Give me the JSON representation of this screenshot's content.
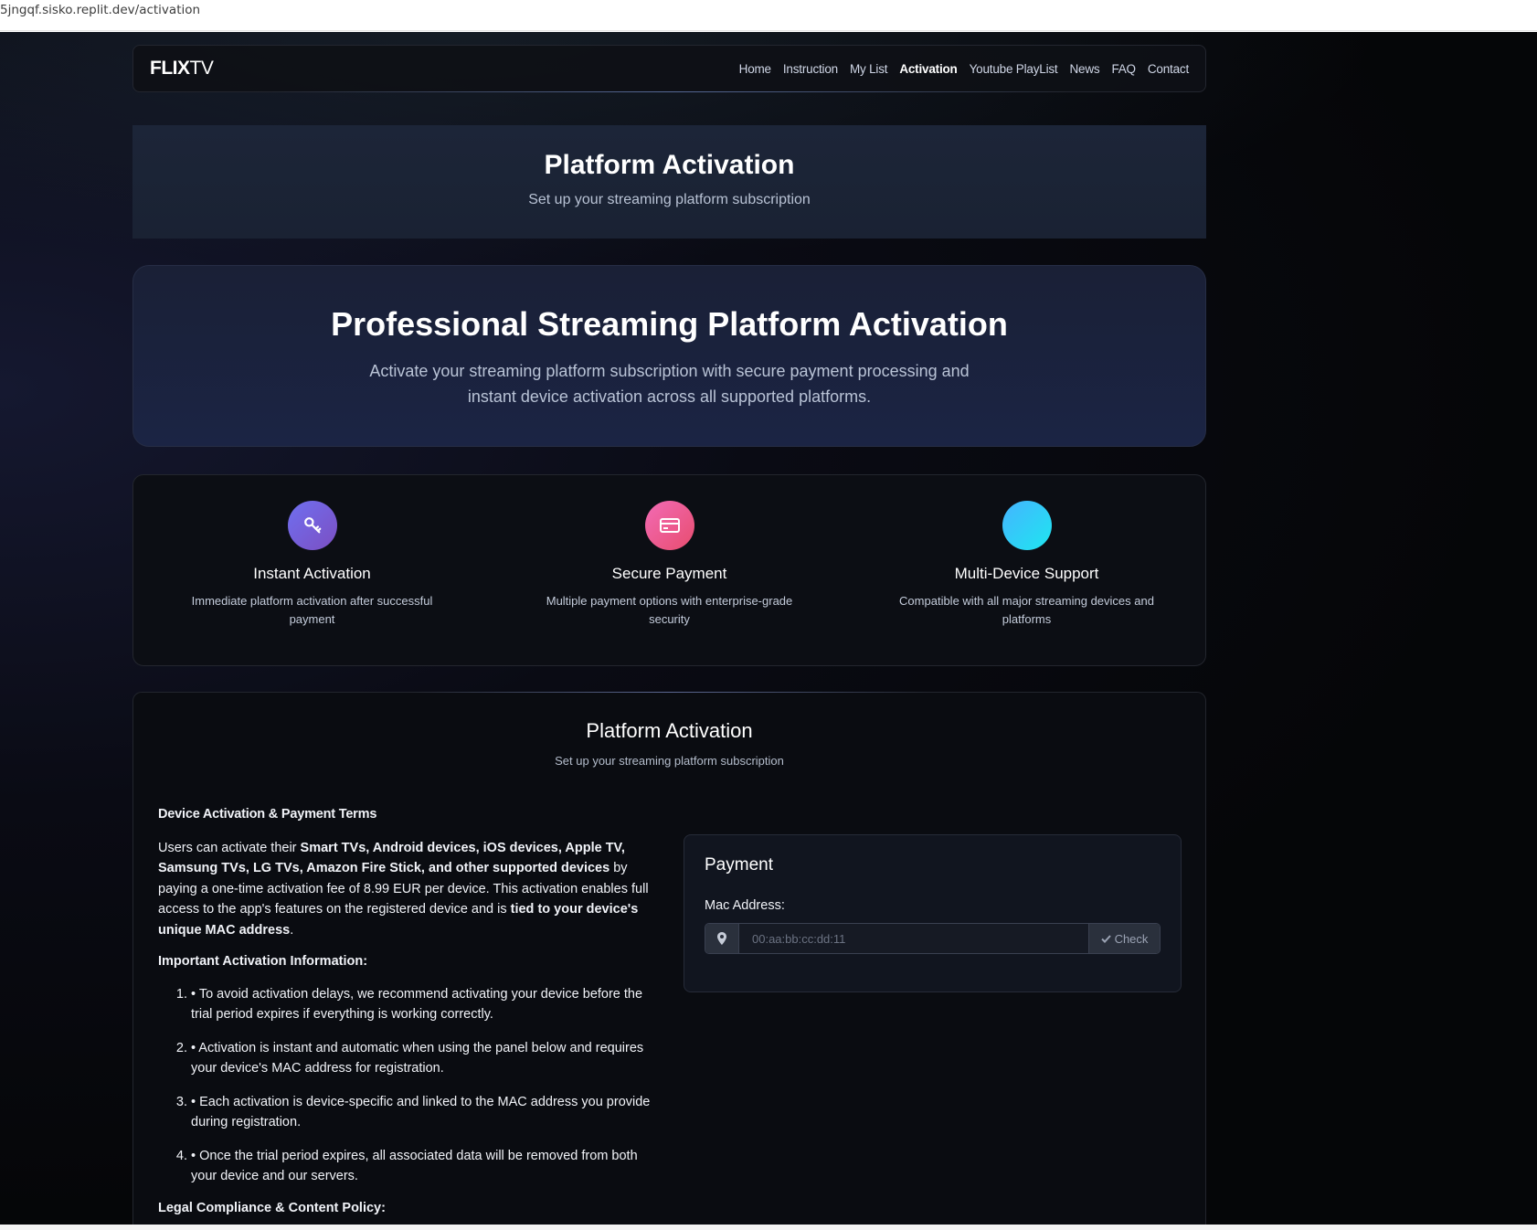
{
  "browser": {
    "url": "5jngqf.sisko.replit.dev/activation"
  },
  "navbar": {
    "brand_bold": "FLIX",
    "brand_light": "TV",
    "links": [
      "Home",
      "Instruction",
      "My List",
      "Activation",
      "Youtube PlayList",
      "News",
      "FAQ",
      "Contact"
    ],
    "active": "Activation"
  },
  "banner": {
    "title": "Platform Activation",
    "subtitle": "Set up your streaming platform subscription"
  },
  "hero": {
    "title": "Professional Streaming Platform Activation",
    "description": "Activate your streaming platform subscription with secure payment processing and instant device activation across all supported platforms."
  },
  "features": [
    {
      "icon": "key-icon",
      "title": "Instant Activation",
      "text": "Immediate platform activation after successful payment",
      "color": "#6f6ff0"
    },
    {
      "icon": "credit-card-icon",
      "title": "Secure Payment",
      "text": "Multiple payment options with enterprise-grade security",
      "color": "#f26bb5"
    },
    {
      "icon": "devices-icon",
      "title": "Multi-Device Support",
      "text": "Compatible with all major streaming devices and platforms",
      "color": "#1ee6f0"
    }
  ],
  "panel": {
    "title": "Platform Activation",
    "subtitle": "Set up your streaming platform subscription"
  },
  "terms": {
    "heading": "Device Activation & Payment Terms",
    "intro_before": "Users can activate their ",
    "intro_bold": "Smart TVs, Android devices, iOS devices, Apple TV, Samsung TVs, LG TVs, Amazon Fire Stick, and other supported devices",
    "intro_middle": " by paying a one-time activation fee of 8.99 EUR per device. This activation enables full access to the app's features on the registered device and is ",
    "intro_bold2": "tied to your device's unique MAC address",
    "intro_end": ".",
    "important_heading": "Important Activation Information:",
    "items": [
      "• To avoid activation delays, we recommend activating your device before the trial period expires if everything is working correctly.",
      "• Activation is instant and automatic when using the panel below and requires your device's MAC address for registration.",
      "• Each activation is device-specific and linked to the MAC address you provide during registration.",
      "• Once the trial period expires, all associated data will be removed from both your device and our servers."
    ],
    "legal_heading": "Legal Compliance & Content Policy:"
  },
  "payment": {
    "title": "Payment",
    "mac_label": "Mac Address:",
    "mac_placeholder": "00:aa:bb:cc:dd:11",
    "mac_value": "",
    "check_label": "Check"
  },
  "colors": {
    "accent_purple": "#6f6ff0",
    "accent_pink": "#f26bb5",
    "accent_cyan": "#1ee6f0",
    "background": "#0a0b14"
  }
}
